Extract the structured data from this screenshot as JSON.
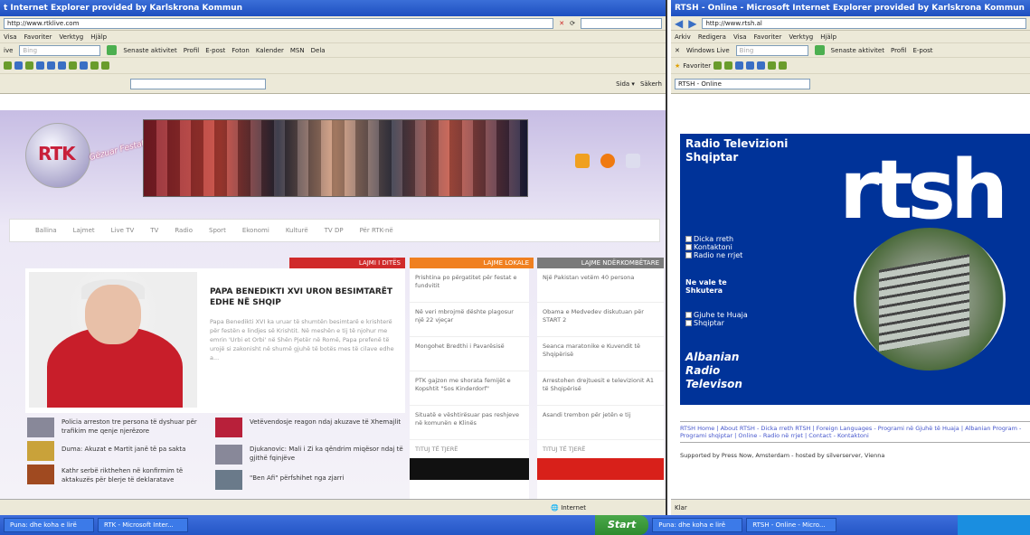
{
  "left_window": {
    "title": "t Internet Explorer provided by Karlskrona Kommun",
    "address": "http://www.rtklive.com",
    "menu": [
      "Visa",
      "Favoriter",
      "Verktyg",
      "Hjälp"
    ],
    "search_prefix": "ive",
    "search_placeholder": "Bing",
    "toolbar": [
      "Senaste aktivitet",
      "Profil",
      "E-post",
      "Foton",
      "Kalender",
      "MSN",
      "Dela"
    ],
    "page_tools": "Sida ▾",
    "safety": "Säkerh",
    "status": "Internet"
  },
  "rtk": {
    "logo": "RTK",
    "greeting": "Gëzuar Festat",
    "nav": [
      "Ballina",
      "Lajmet",
      "Live TV",
      "TV",
      "Radio",
      "Sport",
      "Ekonomi",
      "Kulturë",
      "TV DP",
      "Për RTK-në"
    ],
    "col_heads": [
      "LAJMI I DITËS",
      "LAJME LOKALE",
      "LAJME NDËRKOMBËTARE"
    ],
    "main_headline": "PAPA BENEDIKTI XVI URON BESIMTARËT EDHE NË SHQIP",
    "main_lede": "Papa Benedikti XVI ka uruar të shumtën besimtarë e krishterë për festën e lindjes së Krishtit. Në meshën e tij të njohur me emrin 'Urbi et Orbi' në Shën Pjetër në Romë, Papa prefenë të urojë si zakonisht në shumë gjuhë të botës mes të cilave edhe a...",
    "left_news": [
      "Policia arreston tre persona të dyshuar për trafikim me qenje njerëzore",
      "Duma: Akuzat e Martit janë të pa sakta",
      "Kathr serbë rikthehen në konfirmim të aktakuzës për blerje të deklaratave"
    ],
    "center_news": [
      "Vetëvendosje reagon ndaj akuzave të Xhemajlit",
      "Djukanovic: Mali i Zi ka qëndrim miqësor ndaj të gjithë fqinjëve",
      "\"Ben Afi\" përfshihet nga zjarri"
    ],
    "local": [
      "Prishtina po përgatitet për festat e fundvitit",
      "Në veri mbrojmë dështe plagosur një 22 vjeçar",
      "Mongohet Bredthi i Pavarësisë",
      "PTK gajzon me shorata femijët e Kopshtit \"Sos Kinderdorf\"",
      "Situatë e vështirësuar pas reshjeve në komunën e Klinës"
    ],
    "intl": [
      "Një Pakistan vetëm 40 persona",
      "Obama e Medvedev diskutuan për START 2",
      "Seanca maratonike e Kuvendit të Shqipërisë",
      "Arrestohen drejtuesit e televizionit A1 të Shqipërisë",
      "Asandi trembon për jetën e tij"
    ],
    "more": "TITUJ TË TJERË"
  },
  "right_window": {
    "title": "RTSH - Online - Microsoft Internet Explorer provided by Karlskrona Kommun",
    "address": "http://www.rtsh.al",
    "menu": [
      "Arkiv",
      "Redigera",
      "Visa",
      "Favoriter",
      "Verktyg",
      "Hjälp"
    ],
    "search_label": "Windows Live",
    "search_placeholder": "Bing",
    "toolbar": [
      "Senaste aktivitet",
      "Profil",
      "E-post"
    ],
    "favorites": "Favoriter",
    "tab": "RTSH - Online",
    "status": "Klar"
  },
  "rtsh": {
    "title": "Radio Televizioni Shqiptar",
    "logo": "rtsh",
    "links1": [
      "Dicka rreth",
      "Kontaktoni",
      "Radio ne rrjet"
    ],
    "section": "Ne vale te Shkutera",
    "links2": [
      "Gjuhe te Huaja",
      "Shqiptar"
    ],
    "albanian": "Albanian Radio Televison",
    "footer": "RTSH Home | About RTSH - Dicka rreth RTSH | Foreign Languages - Programi në Gjuhë të Huaja | Albanian Program - Programi shqiptar | Online - Radio në rrjet | Contact - Kontaktoni",
    "supported": "Supported by Press Now, Amsterdam - hosted by silverserver, Vienna"
  },
  "taskbar": {
    "start": "Start",
    "tasks": [
      "Puna: dhe koha e lirë",
      "RTK - Microsoft Inter...",
      "Puna: dhe koha e lirë",
      "RTSH - Online - Micro..."
    ]
  }
}
